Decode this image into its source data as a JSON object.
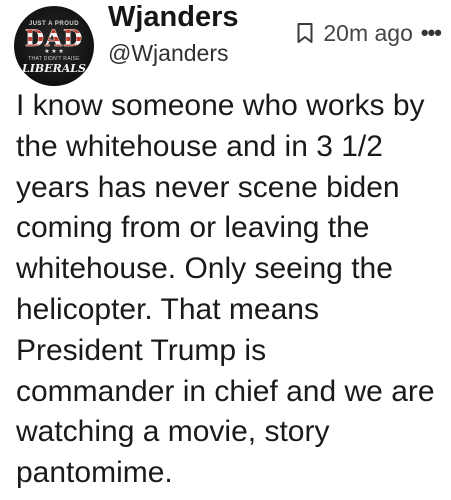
{
  "post": {
    "display_name": "Wjanders",
    "handle": "@Wjanders",
    "timestamp": "20m ago",
    "avatar": {
      "top_text": "JUST A PROUD",
      "big_text": "DAD",
      "stars": "★ ★ ★",
      "mid_text": "THAT DIDN'T RAISE",
      "bottom_text": "LIBERALS"
    },
    "icons": {
      "bookmark": "bookmark-icon",
      "more": "more-icon"
    },
    "text_lines": [
      "I know someone who works by",
      "the whitehouse and in 3 1/2",
      "years has never scene biden",
      "coming from or leaving the",
      "whitehouse. Only seeing the",
      "helicopter. That means",
      "President Trump is",
      "commander in chief and we are",
      "watching a movie, story",
      "pantomime."
    ]
  }
}
